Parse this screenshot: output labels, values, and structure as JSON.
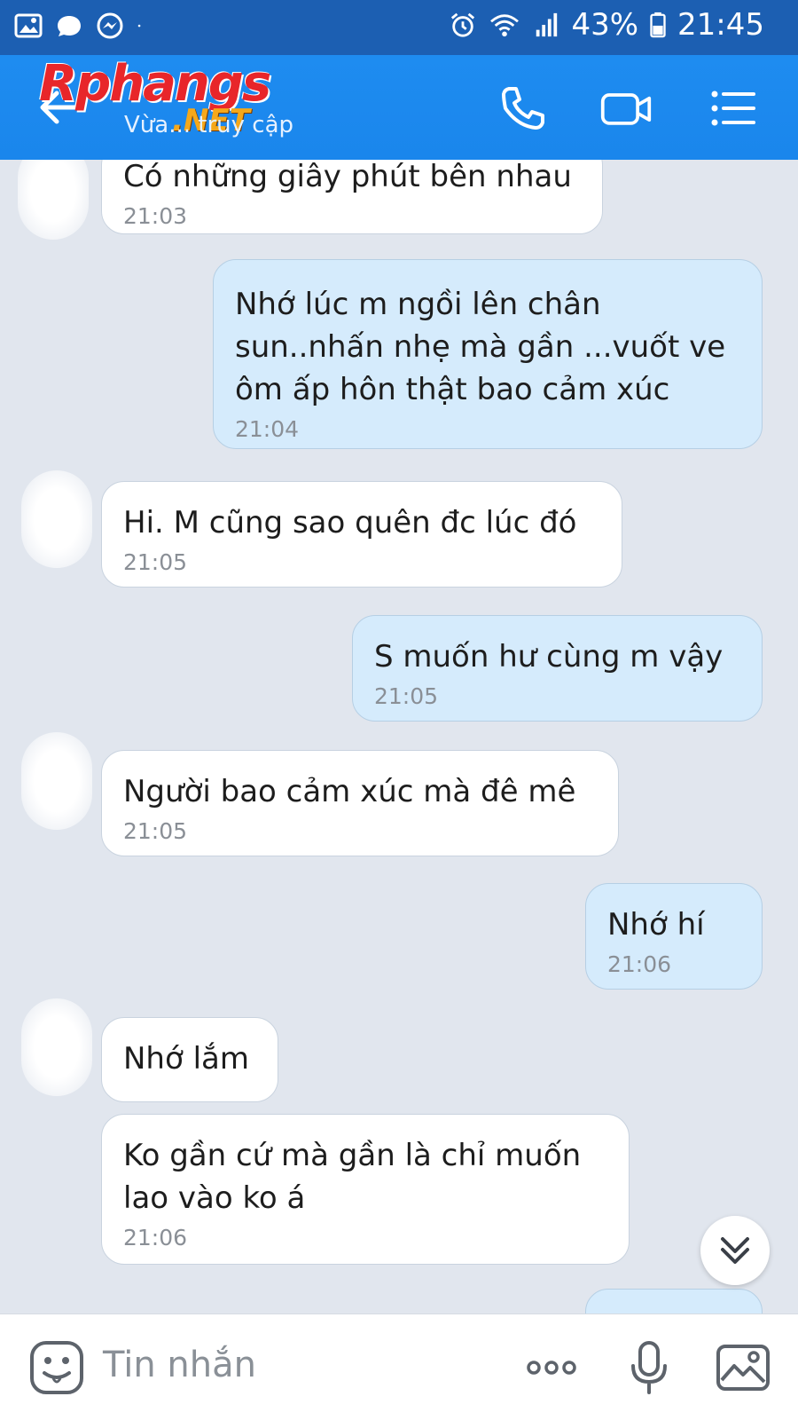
{
  "status_bar": {
    "battery_percent": "43%",
    "time": "21:45"
  },
  "header": {
    "logo_text": "Rphangs",
    "logo_suffix": ".NET",
    "subtitle": "Vừa... truy cập"
  },
  "messages": [
    {
      "dir": "in",
      "text": "Có những giây phút bên nhau",
      "time": "21:03"
    },
    {
      "dir": "out",
      "text": "Nhớ lúc m ngồi lên chân sun..nhấn nhẹ mà gần ...vuốt ve ôm ấp hôn thật bao cảm xúc",
      "time": "21:04"
    },
    {
      "dir": "in",
      "text": "Hi. M cũng sao quên đc lúc đó",
      "time": "21:05"
    },
    {
      "dir": "out",
      "text": "S muốn hư cùng m vậy",
      "time": "21:05"
    },
    {
      "dir": "in",
      "text": "Người bao cảm xúc mà đê mê",
      "time": "21:05"
    },
    {
      "dir": "out",
      "text": "Nhớ hí",
      "time": "21:06"
    },
    {
      "dir": "in",
      "text": "Nhớ lắm",
      "time": ""
    },
    {
      "dir": "in",
      "text": "Ko gần cứ mà gần là chỉ muốn lao vào ko á",
      "time": "21:06"
    }
  ],
  "input": {
    "placeholder": "Tin nhắn"
  },
  "colors": {
    "header": "#1e8cf0",
    "status_bar": "#1c5fb2",
    "background": "#e1e6ee",
    "outgoing_bubble": "#d5ebfc",
    "incoming_bubble": "#ffffff"
  }
}
